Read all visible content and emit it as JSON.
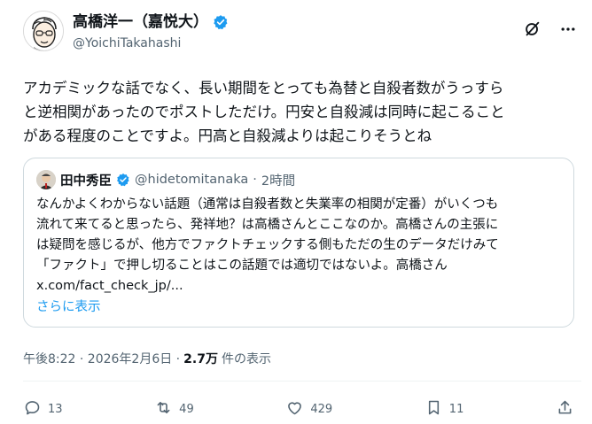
{
  "author": {
    "name": "高橋洋一（嘉悦大）",
    "handle": "@YoichiTakahashi"
  },
  "post": {
    "text": "アカデミックな話でなく、長い期間をとっても為替と自殺者数がうっすら\nと逆相関があったのでポストしただけ。円安と自殺減は同時に起こること\nがある程度のことですよ。円高と自殺減よりは起こりそうとね"
  },
  "quote": {
    "name": "田中秀臣",
    "handle": "@hidetomitanaka",
    "separator": "·",
    "time": "2時間",
    "text": "なんかよくわからない話題（通常は自殺者数と失業率の相関が定番）がいくつも\n流れて来てると思ったら、発祥地？は高橋さんとここなのか。高橋さんの主張に\nは疑問を感じるが、他方でファクトチェックする側もただの生のデータだけみて\n「ファクト」で押し切ることはこの話題では適切ではないよ。高橋さん\nx.com/fact_check_jp/...",
    "show_more": "さらに表示"
  },
  "meta": {
    "timestamp": "午後8:22 · 2026年2月6日 ·",
    "views_count": "2.7万",
    "views_label": "件の表示"
  },
  "actions": {
    "reply_count": "13",
    "repost_count": "49",
    "like_count": "429",
    "bookmark_count": "11"
  },
  "colors": {
    "accent": "#1d9bf0",
    "secondary_text": "#536471",
    "border": "#cfd9de"
  },
  "icons": [
    "grok-icon",
    "more-icon",
    "verified-icon",
    "reply-icon",
    "repost-icon",
    "like-icon",
    "bookmark-icon",
    "share-icon"
  ]
}
